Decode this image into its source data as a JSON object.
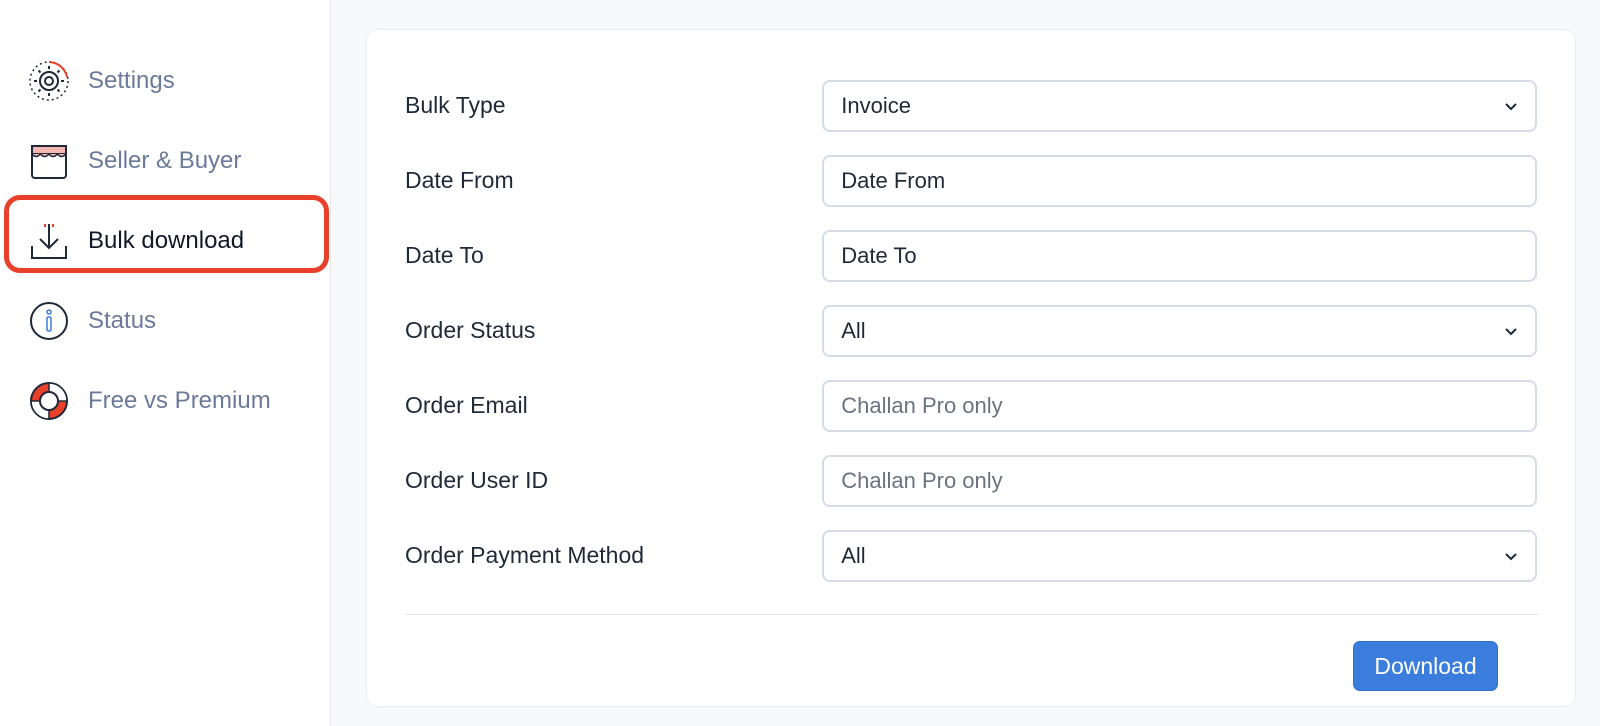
{
  "sidebar": {
    "items": [
      {
        "label": "Settings",
        "icon": "gear-icon",
        "active": false
      },
      {
        "label": "Seller & Buyer",
        "icon": "storefront-icon",
        "active": false
      },
      {
        "label": "Bulk download",
        "icon": "download-icon",
        "active": true
      },
      {
        "label": "Status",
        "icon": "info-icon",
        "active": false
      },
      {
        "label": "Free vs Premium",
        "icon": "lifebuoy-icon",
        "active": false
      }
    ]
  },
  "form": {
    "fields": [
      {
        "label": "Bulk Type",
        "type": "select",
        "value": "Invoice"
      },
      {
        "label": "Date From",
        "type": "input",
        "placeholder": "Date From"
      },
      {
        "label": "Date To",
        "type": "input",
        "placeholder": "Date To"
      },
      {
        "label": "Order Status",
        "type": "select",
        "value": "All"
      },
      {
        "label": "Order Email",
        "type": "input",
        "placeholder": "Challan Pro only"
      },
      {
        "label": "Order User ID",
        "type": "input",
        "placeholder": "Challan Pro only"
      },
      {
        "label": "Order Payment Method",
        "type": "select",
        "value": "All"
      }
    ],
    "download_label": "Download"
  },
  "colors": {
    "accent": "#3b7ddd",
    "active_highlight": "#e8402a",
    "sidebar_text": "#6b7a99"
  }
}
